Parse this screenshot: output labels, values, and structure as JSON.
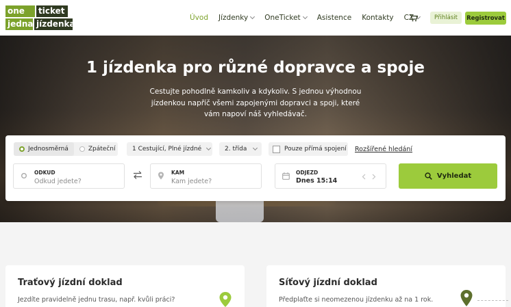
{
  "header": {
    "logo": {
      "l1": "one",
      "l2": "ticket",
      "l3": "jedna",
      "l4": "jízdenka"
    },
    "nav": [
      {
        "label": "Úvod"
      },
      {
        "label": "Jízdenky"
      },
      {
        "label": "OneTicket"
      },
      {
        "label": "Asistence"
      },
      {
        "label": "Kontakty"
      },
      {
        "label": "CZ"
      }
    ],
    "cart_icon": "cart-icon",
    "login_label": "Přihlásit",
    "register_label": "Registrovat"
  },
  "hero": {
    "title": "1 jízdenka pro různé dopravce a spoje",
    "subtitle_lines": [
      "Cestujte pohodlně kamkoliv a kdykoliv. S jednou výhodnou",
      "jízdenkou napříč všemi zapojenými dopravci a spoji, které",
      "vám napoví náš vyhledávač."
    ]
  },
  "search": {
    "trip_type": {
      "one_way": "Jednosměrná",
      "return": "Zpáteční",
      "selected": "one_way"
    },
    "passengers": "1 Cestující, Plné jízdné",
    "class": "2. třída",
    "direct_only": "Pouze přímá spojení",
    "advanced": "Rozšířené hledání",
    "from": {
      "label": "ODKUD",
      "placeholder": "Odkud jedete?"
    },
    "to": {
      "label": "KAM",
      "placeholder": "Kam jedete?"
    },
    "departure": {
      "label": "ODJEZD",
      "value": "Dnes 15:14"
    },
    "search_button": "Vyhledat"
  },
  "cards": [
    {
      "title": "Traťový jízdní doklad",
      "text": "Jezdíte pravidelně jednu trasu, např. kvůli práci?"
    },
    {
      "title": "Síťový jízdní doklad",
      "text": "Předplaťte si neomezenou jízdenku až na 1 rok."
    }
  ],
  "colors": {
    "accent": "#9ccb3c",
    "accent_dark": "#7ca22b",
    "logo_dark": "#2f3a21"
  }
}
